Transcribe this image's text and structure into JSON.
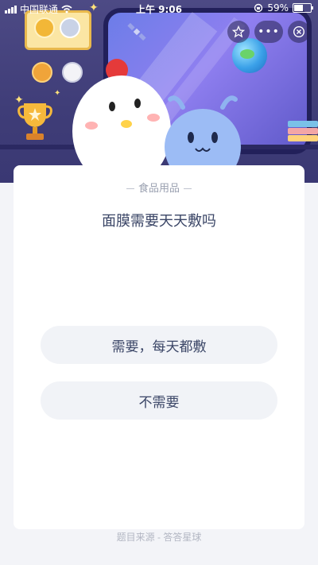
{
  "status_bar": {
    "carrier": "中国联通",
    "time": "上午 9:06",
    "battery": "59%"
  },
  "nav_capsule": {
    "more_label": "•••"
  },
  "question_card": {
    "category": "食品用品",
    "question": "面膜需要天天敷吗",
    "options": [
      {
        "label": "需要，每天都敷"
      },
      {
        "label": "不需要"
      }
    ],
    "source": "题目来源 - 答答星球"
  },
  "icons": {
    "star": "star-icon",
    "close": "close-icon",
    "wifi": "wifi-icon",
    "signal": "signal-icon",
    "battery": "battery-icon",
    "lock_rotation": "rotation-lock-icon"
  },
  "colors": {
    "banner_bg": "#4d4a85",
    "text_primary": "#3a4566",
    "text_muted": "#9aa0b0",
    "option_bg": "#f1f3f7"
  }
}
